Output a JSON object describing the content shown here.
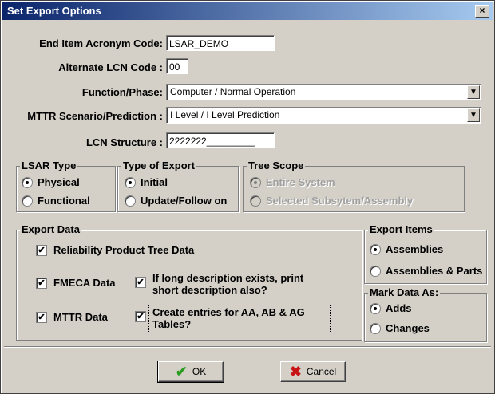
{
  "window": {
    "title": "Set Export Options",
    "close": "×"
  },
  "fields": {
    "eia_label": "End Item Acronym Code:",
    "eia_value": "LSAR_DEMO",
    "alt_lcn_label": "Alternate LCN Code :",
    "alt_lcn_value": "00",
    "function_label": "Function/Phase:",
    "function_value": "Computer / Normal Operation",
    "mttr_label": "MTTR Scenario/Prediction :",
    "mttr_value": "I Level / I Level Prediction",
    "lcn_label": "LCN Structure :",
    "lcn_value": "2222222_________"
  },
  "lsar_type": {
    "legend": "LSAR Type",
    "options": [
      "Physical",
      "Functional"
    ],
    "selected": "Physical"
  },
  "export_type": {
    "legend": "Type of Export",
    "options": [
      "Initial",
      "Update/Follow on"
    ],
    "selected": "Initial"
  },
  "tree_scope": {
    "legend": "Tree Scope",
    "options": [
      "Entire System",
      "Selected Subsytem/Assembly"
    ],
    "selected": "Entire System",
    "disabled": true
  },
  "export_data": {
    "legend": "Export Data",
    "reliability": "Reliability Product Tree Data",
    "fmeca": "FMECA Data",
    "long_desc_1": "If long description exists, print",
    "long_desc_2": "short description also?",
    "mttr": "MTTR Data",
    "aa_1": "Create entries for AA, AB & AG",
    "aa_2": "Tables?",
    "checkmark": "✔"
  },
  "export_items": {
    "legend": "Export Items",
    "options": [
      "Assemblies",
      "Assemblies & Parts"
    ],
    "selected": "Assemblies"
  },
  "mark_data": {
    "legend": "Mark Data As:",
    "adds": "Adds",
    "changes": "Changes",
    "selected": "Adds"
  },
  "buttons": {
    "ok": "OK",
    "cancel": "Cancel",
    "ok_icon": "✔",
    "cancel_icon": "✖"
  },
  "colors": {
    "title_start": "#0a246a",
    "title_end": "#a6caf0",
    "face": "#d4d0c8",
    "ok_icon": "#2a9d1f",
    "cancel_icon": "#c81414"
  }
}
